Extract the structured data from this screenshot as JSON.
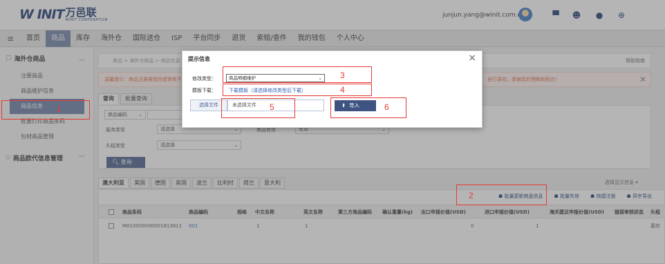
{
  "header": {
    "logo_mark": "W INIT",
    "logo_brand": "万邑联",
    "logo_sub": "WINIT CORPORATION",
    "user_email": "junjun.yang@winit.com.cn"
  },
  "nav": {
    "items": [
      "首页",
      "商品",
      "库存",
      "海外仓",
      "国际送仓",
      "ISP",
      "平台同步",
      "退货",
      "索赔/查件",
      "我的钱包",
      "个人中心"
    ],
    "active_index": 1
  },
  "sidebar": {
    "group1": "海外仓商品",
    "items": [
      "注册商品",
      "商品维护信息",
      "商品信息",
      "批量打印商品条码",
      "包材商品管理"
    ],
    "active_index": 2,
    "group2": "商品欧代信息管理"
  },
  "main": {
    "breadcrumb": "商品 > 海外仓商品 > 商品信息",
    "help": "帮助指南",
    "alert_left": "温馨提示：商品注册被驳回或审核不通过的...",
    "alert_right": "自行录控，感谢您的理解和配合！",
    "tabs": [
      "查询",
      "批量查询"
    ],
    "filters": {
      "code_select": "商品编码",
      "service_label": "服务类型",
      "service_value": "请选择",
      "effect_label": "商品有效",
      "effect_value": "有效",
      "head_label": "头程类型",
      "head_value": "请选择",
      "query_button": "查询"
    },
    "country_tabs": [
      "澳大利亚",
      "美国",
      "德国",
      "英国",
      "波兰",
      "比利时",
      "荷兰",
      "意大利"
    ],
    "display_info": "选择显示信息 ▾",
    "toolbar": [
      "批量更新商品信息",
      "批量失效",
      "快捷注册",
      "异步导出"
    ],
    "columns": [
      "商品条码",
      "商品编码",
      "规格",
      "中文名称",
      "英文名称",
      "第三方商品编码",
      "确认重量(kg)",
      "出口申报价值(USD)",
      "进口申报价值(USD)",
      "海关建议申报价值(USD)",
      "链接审核状态",
      "头程"
    ],
    "row": [
      "M010000000001813611",
      "001",
      "1",
      "1",
      "0",
      "1"
    ],
    "row_tail": "嘉欢"
  },
  "modal": {
    "title": "提示信息",
    "type_label": "修改类型：",
    "type_value": "商品明细维护",
    "template_label": "模板下载：",
    "template_link": "下载模板（请选择修改类型后下载）",
    "file_button": "选择文件",
    "file_name": "未选择文件",
    "import_button": "导入"
  },
  "annotations": [
    "1",
    "2",
    "3",
    "4",
    "5",
    "6"
  ],
  "colors": {
    "accent": "#4a5f8f",
    "annotation": "#e53935",
    "link": "#2e5eb3"
  }
}
